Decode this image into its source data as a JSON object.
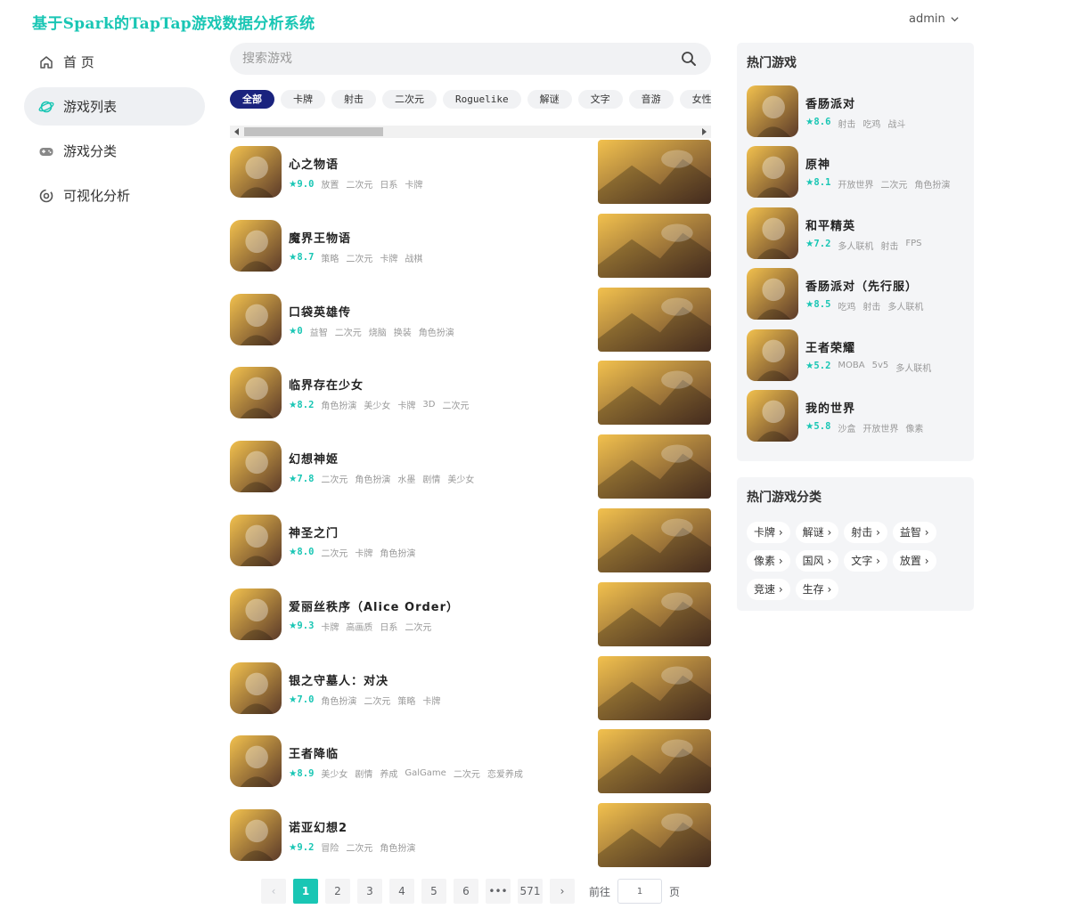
{
  "header": {
    "title": "基于Spark的TapTap游戏数据分析系统",
    "user": "admin"
  },
  "sidebar": {
    "items": [
      {
        "label": "首 页",
        "icon": "home-icon",
        "active": false
      },
      {
        "label": "游戏列表",
        "icon": "planet-icon",
        "active": true
      },
      {
        "label": "游戏分类",
        "icon": "gamepad-icon",
        "active": false
      },
      {
        "label": "可视化分析",
        "icon": "chart-ring-icon",
        "active": false
      }
    ]
  },
  "search": {
    "placeholder": "搜索游戏"
  },
  "tags": [
    "全部",
    "卡牌",
    "射击",
    "二次元",
    "Roguelike",
    "解谜",
    "文字",
    "音游",
    "女性"
  ],
  "games": [
    {
      "name": "心之物语",
      "rating": "9.0",
      "tags": [
        "放置",
        "二次元",
        "日系",
        "卡牌"
      ],
      "colors": [
        "#f2c14e",
        "#5b3a29"
      ],
      "banner": [
        "#2a2f7a",
        "#6b5fd1"
      ]
    },
    {
      "name": "魔界王物语",
      "rating": "8.7",
      "tags": [
        "策略",
        "二次元",
        "卡牌",
        "战棋"
      ],
      "colors": [
        "#d9d9d9",
        "#5a5a66"
      ],
      "banner": [
        "#3a1f5c",
        "#b58cd8"
      ]
    },
    {
      "name": "口袋英雄传",
      "rating": "0",
      "tags": [
        "益智",
        "二次元",
        "烧脑",
        "换装",
        "角色扮演"
      ],
      "colors": [
        "#d6362b",
        "#f5b94a"
      ],
      "banner": [
        "#3a2a26",
        "#d35a2a"
      ]
    },
    {
      "name": "临界存在少女",
      "rating": "8.2",
      "tags": [
        "角色扮演",
        "美少女",
        "卡牌",
        "3D",
        "二次元"
      ],
      "colors": [
        "#e4e6ec",
        "#3b3f58"
      ],
      "banner": [
        "#dfe6ee",
        "#7a8aa6"
      ]
    },
    {
      "name": "幻想神姬",
      "rating": "7.8",
      "tags": [
        "二次元",
        "角色扮演",
        "水墨",
        "剧情",
        "美少女"
      ],
      "colors": [
        "#6b2a2a",
        "#e6c2b0"
      ],
      "banner": [
        "#e8e2d4",
        "#2d5b5a"
      ]
    },
    {
      "name": "神圣之门",
      "rating": "8.0",
      "tags": [
        "二次元",
        "卡牌",
        "角色扮演"
      ],
      "colors": [
        "#f3dcb0",
        "#7a4b2e"
      ],
      "banner": [
        "#5b8fd6",
        "#2b3e6b"
      ]
    },
    {
      "name": "爱丽丝秩序（Alice Order）",
      "rating": "9.3",
      "tags": [
        "卡牌",
        "高画质",
        "日系",
        "二次元"
      ],
      "colors": [
        "#f0f0f0",
        "#8a1f2a"
      ],
      "banner": [
        "#1c5b66",
        "#c23a4e"
      ]
    },
    {
      "name": "银之守墓人：对决",
      "rating": "7.0",
      "tags": [
        "角色扮演",
        "二次元",
        "策略",
        "卡牌"
      ],
      "colors": [
        "#2a8fe0",
        "#f4d9c6"
      ],
      "banner": [
        "#7a5fc4",
        "#c23a4e"
      ]
    },
    {
      "name": "王者降临",
      "rating": "8.9",
      "tags": [
        "美少女",
        "剧情",
        "养成",
        "GalGame",
        "二次元",
        "恋爱养成"
      ],
      "colors": [
        "#f4eee8",
        "#c2303a"
      ],
      "banner": [
        "#1bb3b8",
        "#3a1f5c"
      ]
    },
    {
      "name": "诺亚幻想2",
      "rating": "9.2",
      "tags": [
        "冒险",
        "二次元",
        "角色扮演"
      ],
      "colors": [
        "#f1e2c6",
        "#5a7fb8"
      ],
      "banner": [
        "#4a2a2e",
        "#e6d2d6"
      ]
    }
  ],
  "pagination": {
    "prev": "‹",
    "pages": [
      "1",
      "2",
      "3",
      "4",
      "5",
      "6",
      "•••",
      "571"
    ],
    "active": "1",
    "next": "›",
    "goto_label": "前往",
    "goto_value": "1",
    "page_suffix": "页"
  },
  "hot_games": {
    "title": "热门游戏",
    "items": [
      {
        "name": "香肠派对",
        "rating": "8.6",
        "tags": [
          "射击",
          "吃鸡",
          "战斗"
        ],
        "colors": [
          "#5bc0e8",
          "#e8d06b"
        ]
      },
      {
        "name": "原神",
        "rating": "8.1",
        "tags": [
          "开放世界",
          "二次元",
          "角色扮演"
        ],
        "colors": [
          "#f4f0ea",
          "#2a2a3a"
        ]
      },
      {
        "name": "和平精英",
        "rating": "7.2",
        "tags": [
          "多人联机",
          "射击",
          "FPS"
        ],
        "colors": [
          "#c58a2a",
          "#6b3a1a"
        ]
      },
      {
        "name": "香肠派对（先行服）",
        "rating": "8.5",
        "tags": [
          "吃鸡",
          "射击",
          "多人联机"
        ],
        "colors": [
          "#5bb86b",
          "#e8d06b"
        ]
      },
      {
        "name": "王者荣耀",
        "rating": "5.2",
        "tags": [
          "MOBA",
          "5v5",
          "多人联机"
        ],
        "colors": [
          "#e06a2a",
          "#7a2a1a"
        ]
      },
      {
        "name": "我的世界",
        "rating": "5.8",
        "tags": [
          "沙盒",
          "开放世界",
          "像素"
        ],
        "colors": [
          "#7ac04a",
          "#c2303a"
        ]
      }
    ]
  },
  "hot_categories": {
    "title": "热门游戏分类",
    "items": [
      "卡牌",
      "解谜",
      "射击",
      "益智",
      "像素",
      "国风",
      "文字",
      "放置",
      "竞速",
      "生存"
    ]
  },
  "accent_color": "#19c6b4",
  "active_tag_color": "#1a237e"
}
